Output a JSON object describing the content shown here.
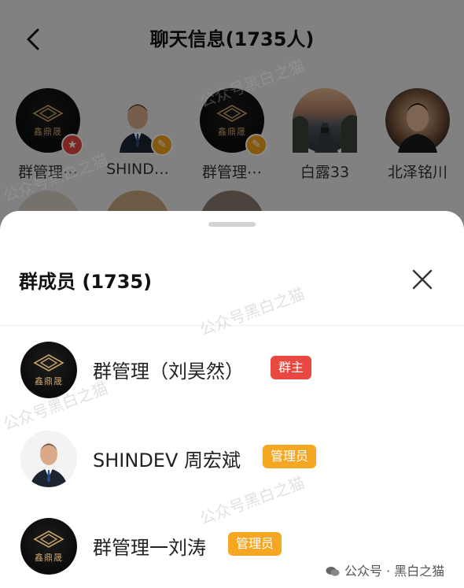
{
  "nav": {
    "title": "聊天信息(1735人)"
  },
  "member_grid": [
    {
      "name": "群管理⋯",
      "avatar": "logo",
      "corner": "star"
    },
    {
      "name": "SHIND…",
      "avatar": "person",
      "corner": "admin"
    },
    {
      "name": "群管理⋯",
      "avatar": "logo",
      "corner": "admin"
    },
    {
      "name": "白露33",
      "avatar": "road",
      "corner": ""
    },
    {
      "name": "北泽铭川",
      "avatar": "man2",
      "corner": ""
    }
  ],
  "sheet": {
    "title": "群成员 (1735)",
    "members": [
      {
        "name": "群管理（刘昊然）",
        "badge": "群主",
        "avatar": "logo"
      },
      {
        "name": "SHINDEV 周宏斌",
        "badge": "管理员",
        "avatar": "person"
      },
      {
        "name": "群管理一刘涛",
        "badge": "管理员",
        "avatar": "logo"
      }
    ]
  },
  "logo_text": "鑫鼎晟",
  "watermark": "公众号黑白之猫",
  "footer_watermark": "公众号 · 黑白之猫",
  "colors": {
    "owner_badge": "#e8483f",
    "admin_badge": "#f5a623",
    "gold": "#caa26a"
  },
  "icons": {
    "back": "chevron-left-icon",
    "close": "close-icon",
    "star": "star-icon",
    "admin": "admin-icon"
  }
}
